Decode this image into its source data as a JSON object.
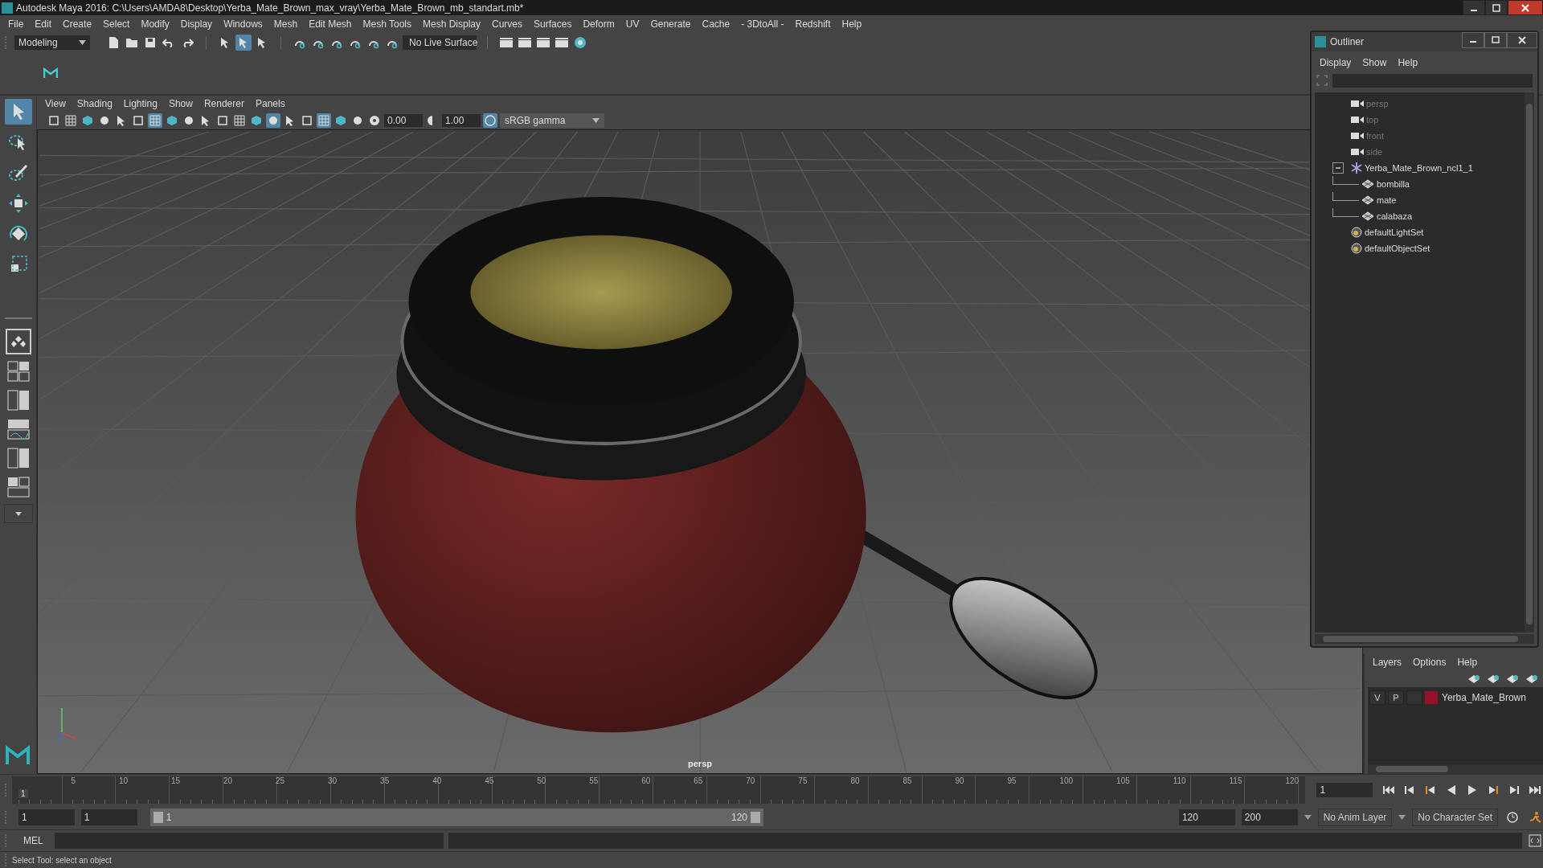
{
  "window": {
    "title": "Autodesk Maya 2016: C:\\Users\\AMDA8\\Desktop\\Yerba_Mate_Brown_max_vray\\Yerba_Mate_Brown_mb_standart.mb*"
  },
  "menu": [
    "File",
    "Edit",
    "Create",
    "Select",
    "Modify",
    "Display",
    "Windows",
    "Mesh",
    "Edit Mesh",
    "Mesh Tools",
    "Mesh Display",
    "Curves",
    "Surfaces",
    "Deform",
    "UV",
    "Generate",
    "Cache",
    "- 3DtoAll -",
    "Redshift",
    "Help"
  ],
  "status_line": {
    "mode": "Modeling",
    "live_surface": "No Live Surface",
    "selection_buttons": [
      {
        "selected": false
      },
      {
        "selected": true
      },
      {
        "selected": false
      }
    ]
  },
  "tools": [
    {
      "kind": "select",
      "selected": true
    },
    {
      "kind": "lasso",
      "selected": false
    },
    {
      "kind": "paint",
      "selected": false
    },
    {
      "kind": "move",
      "selected": false
    },
    {
      "kind": "rotate",
      "selected": false
    },
    {
      "kind": "scale",
      "selected": false
    }
  ],
  "viewport": {
    "menu": [
      "View",
      "Shading",
      "Lighting",
      "Show",
      "Renderer",
      "Panels"
    ],
    "buttons": [
      {
        "selected": false
      },
      {
        "selected": false
      },
      {
        "selected": false
      },
      {
        "selected": false
      },
      {
        "selected": false
      },
      {
        "selected": false
      },
      {
        "selected": true
      },
      {
        "selected": false
      },
      {
        "selected": false
      },
      {
        "selected": false
      },
      {
        "selected": false
      },
      {
        "selected": false
      },
      {
        "selected": false
      },
      {
        "selected": true
      },
      {
        "selected": false
      },
      {
        "selected": false
      },
      {
        "selected": true
      },
      {
        "selected": false
      },
      {
        "selected": false
      }
    ],
    "exposure": "0.00",
    "gamma": "1.00",
    "color_space": "sRGB gamma",
    "camera_label": "persp"
  },
  "outliner": {
    "title": "Outliner",
    "menu": [
      "Display",
      "Show",
      "Help"
    ],
    "items": [
      {
        "label": "persp",
        "kind": "camera",
        "dimmed": true
      },
      {
        "label": "top",
        "kind": "camera",
        "dimmed": true
      },
      {
        "label": "front",
        "kind": "camera",
        "dimmed": true
      },
      {
        "label": "side",
        "kind": "camera",
        "dimmed": true
      },
      {
        "label": "Yerba_Mate_Brown_ncl1_1",
        "kind": "group",
        "dimmed": false,
        "expanded": true,
        "children": [
          {
            "label": "bombilla",
            "kind": "mesh",
            "dimmed": false
          },
          {
            "label": "mate",
            "kind": "mesh",
            "dimmed": false
          },
          {
            "label": "calabaza",
            "kind": "mesh",
            "dimmed": false
          }
        ]
      },
      {
        "label": "defaultLightSet",
        "kind": "set",
        "dimmed": false
      },
      {
        "label": "defaultObjectSet",
        "kind": "set",
        "dimmed": false
      }
    ]
  },
  "layers": {
    "menu": [
      "Layers",
      "Options",
      "Help"
    ],
    "rows": [
      {
        "visible": "V",
        "playback": "P",
        "name": "Yerba_Mate_Brown",
        "color": "#9a0f2c"
      }
    ]
  },
  "timeline": {
    "start_label": "1",
    "ticks": [
      "5",
      "10",
      "15",
      "20",
      "25",
      "30",
      "35",
      "40",
      "45",
      "50",
      "55",
      "60",
      "65",
      "70",
      "75",
      "80",
      "85",
      "90",
      "95",
      "100",
      "105",
      "110",
      "115",
      "120"
    ],
    "current_frame": "1"
  },
  "range": {
    "level": 0.6,
    "start": "1",
    "playback_start": "1",
    "slider_start": "1",
    "slider_end": "120",
    "playback_end": "120",
    "end": "200",
    "anim_layer": "No Anim Layer",
    "character_set": "No Character Set"
  },
  "command": {
    "label": "MEL"
  },
  "status": "Select Tool: select an object"
}
